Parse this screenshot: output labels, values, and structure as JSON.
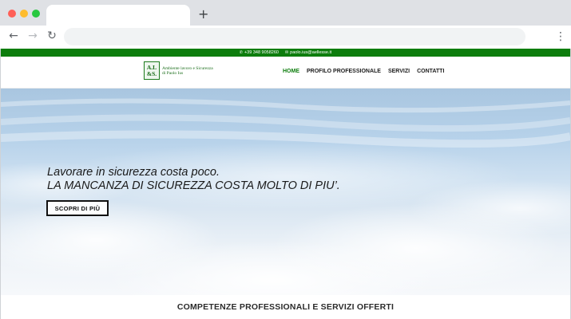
{
  "browser": {
    "window_controls": [
      {
        "name": "close",
        "color": "#ff5f57"
      },
      {
        "name": "minimize",
        "color": "#febc2e"
      },
      {
        "name": "maximize",
        "color": "#28c840"
      }
    ],
    "new_tab_symbol": "+",
    "back_symbol": "←",
    "forward_symbol": "→",
    "reload_symbol": "↻",
    "menu_symbol": "⋮",
    "address": ""
  },
  "site": {
    "topbar": {
      "phone_icon": "phone-icon",
      "phone": "+39 348 9058260",
      "email_icon": "mail-icon",
      "email": "paolo.ius@aellesse.it",
      "color": "#0d7d0d"
    },
    "logo": {
      "box_line1": "A.L",
      "box_line2": "&S.",
      "text_line1": "Ambiente lavoro e Sicurezza",
      "text_line2": "di Paolo Ius"
    },
    "menu": [
      {
        "label": "HOME",
        "active": true
      },
      {
        "label": "PROFILO PROFESSIONALE",
        "active": false
      },
      {
        "label": "SERVIZI",
        "active": false
      },
      {
        "label": "CONTATTI",
        "active": false
      }
    ],
    "hero": {
      "line1": "Lavorare in sicurezza costa poco.",
      "line2": "LA MANCANZA DI SICUREZZA COSTA MOLTO DI PIU’.",
      "cta": "SCOPRI DI PIÙ"
    },
    "section_title": "COMPETENZE PROFESSIONALI E SERVIZI OFFERTI"
  }
}
